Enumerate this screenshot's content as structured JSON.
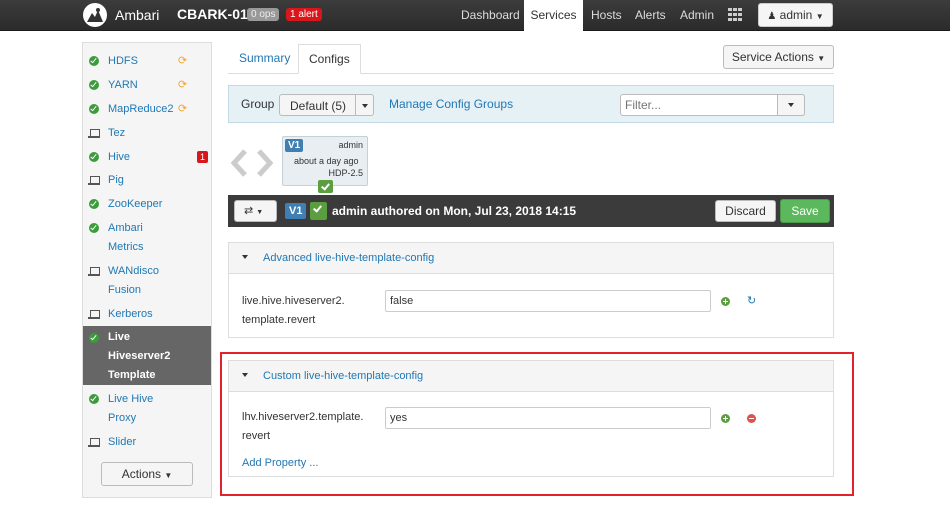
{
  "navbar": {
    "brand": "Ambari",
    "cluster_name": "CBARK-01",
    "ops_badge": "0 ops",
    "alert_badge": "1 alert",
    "links": [
      {
        "label": "Dashboard"
      },
      {
        "label": "Services"
      },
      {
        "label": "Hosts"
      },
      {
        "label": "Alerts"
      },
      {
        "label": "Admin"
      }
    ],
    "active_link": "Services",
    "user_label": "admin"
  },
  "sidebar": {
    "items": [
      {
        "line1": "HDFS",
        "line2": "",
        "status": "ok",
        "restart": true
      },
      {
        "line1": "YARN",
        "line2": "",
        "status": "ok",
        "restart": true
      },
      {
        "line1": "MapReduce2",
        "line2": "",
        "status": "ok",
        "restart": true
      },
      {
        "line1": "Tez",
        "line2": "",
        "status": "client"
      },
      {
        "line1": "Hive",
        "line2": "",
        "status": "ok",
        "alerts": "1"
      },
      {
        "line1": "Pig",
        "line2": "",
        "status": "client"
      },
      {
        "line1": "ZooKeeper",
        "line2": "",
        "status": "ok"
      },
      {
        "line1": "Ambari",
        "line2": "Metrics",
        "status": "ok"
      },
      {
        "line1": "WANdisco",
        "line2": "Fusion",
        "status": "client"
      },
      {
        "line1": "Kerberos",
        "line2": "",
        "status": "client"
      },
      {
        "line1": "Live",
        "line2": "Hiveserver2",
        "line3": "Template",
        "status": "ok",
        "active": true
      },
      {
        "line1": "Live Hive",
        "line2": "Proxy",
        "status": "ok"
      },
      {
        "line1": "Slider",
        "line2": "",
        "status": "client"
      }
    ],
    "actions_label": "Actions"
  },
  "tabs": {
    "summary": "Summary",
    "configs": "Configs",
    "active": "Configs"
  },
  "service_actions_label": "Service Actions",
  "group_bar": {
    "label": "Group",
    "selected": "Default (5)",
    "manage_link": "Manage Config Groups",
    "filter_placeholder": "Filter..."
  },
  "version_card": {
    "version": "V1",
    "author": "admin",
    "time": "about a day ago",
    "stack": "HDP-2.5"
  },
  "version_bar": {
    "version": "V1",
    "authored_text": "admin authored on Mon, Jul 23, 2018 14:15",
    "discard_label": "Discard",
    "save_label": "Save"
  },
  "advanced_section": {
    "title": "Advanced live-hive-template-config",
    "property_name_line1": "live.hive.hiveserver2.",
    "property_name_line2": "template.revert",
    "property_value": "false"
  },
  "custom_section": {
    "title": "Custom live-hive-template-config",
    "property_name_line1": "lhv.hiveserver2.template.",
    "property_name_line2": "revert",
    "property_value": "yes",
    "add_property_label": "Add Property ..."
  },
  "colors": {
    "link": "#1f78b4",
    "ok_green": "#3c9c3c",
    "alert_red": "#d9161c",
    "highlight_border": "#e3232b"
  }
}
